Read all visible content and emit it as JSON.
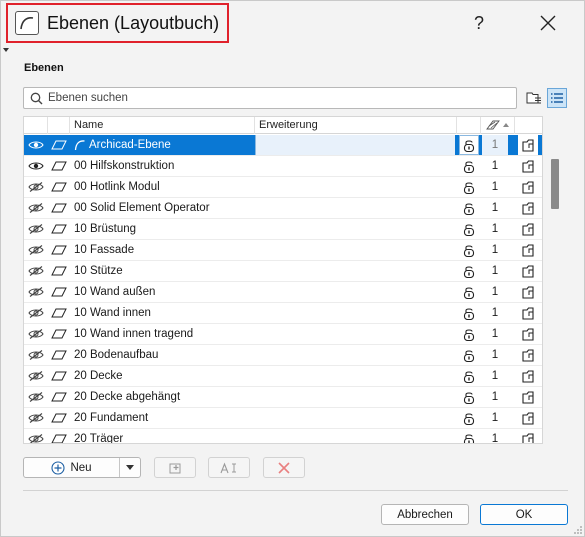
{
  "window": {
    "title": "Ebenen (Layoutbuch)",
    "help": "?"
  },
  "section": {
    "label": "Ebenen"
  },
  "search": {
    "placeholder": "Ebenen suchen"
  },
  "table": {
    "columns": {
      "name": "Name",
      "extension": "Erweiterung"
    },
    "rows": [
      {
        "name": "Archicad-Ebene",
        "visible": true,
        "num": "1",
        "selected": true
      },
      {
        "name": "00 Hilfskonstruktion",
        "visible": true,
        "num": "1"
      },
      {
        "name": "00 Hotlink Modul",
        "visible": false,
        "num": "1"
      },
      {
        "name": "00 Solid Element Operator",
        "visible": false,
        "num": "1"
      },
      {
        "name": "10 Brüstung",
        "visible": false,
        "num": "1"
      },
      {
        "name": "10 Fassade",
        "visible": false,
        "num": "1"
      },
      {
        "name": "10 Stütze",
        "visible": false,
        "num": "1"
      },
      {
        "name": "10 Wand außen",
        "visible": false,
        "num": "1"
      },
      {
        "name": "10 Wand innen",
        "visible": false,
        "num": "1"
      },
      {
        "name": "10 Wand innen tragend",
        "visible": false,
        "num": "1"
      },
      {
        "name": "20 Bodenaufbau",
        "visible": false,
        "num": "1"
      },
      {
        "name": "20 Decke",
        "visible": false,
        "num": "1"
      },
      {
        "name": "20 Decke abgehängt",
        "visible": false,
        "num": "1"
      },
      {
        "name": "20 Fundament",
        "visible": false,
        "num": "1"
      },
      {
        "name": "20 Träger",
        "visible": false,
        "num": "1"
      }
    ]
  },
  "toolbar": {
    "new_label": "Neu"
  },
  "buttons": {
    "cancel": "Abbrechen",
    "ok": "OK"
  },
  "colors": {
    "accent": "#0a78d4",
    "highlight_border": "#e0212b"
  },
  "icons": [
    "app-icon",
    "help-icon",
    "close-icon",
    "search-icon",
    "folder-view-icon",
    "list-view-icon",
    "eye-icon",
    "eye-hidden-icon",
    "layer-icon",
    "lock-icon",
    "wireframe-icon",
    "add-icon",
    "new-layer-combination-icon",
    "rename-icon",
    "delete-icon"
  ]
}
